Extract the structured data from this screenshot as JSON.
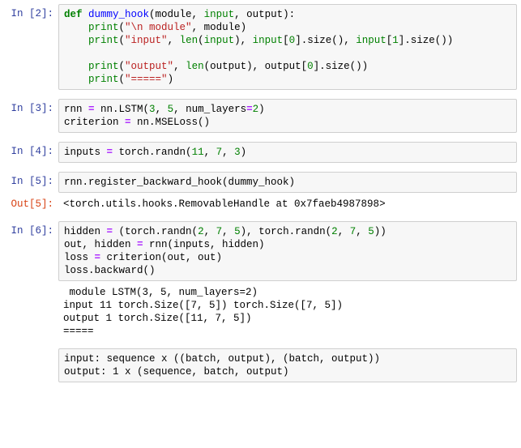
{
  "notebook": {
    "cells": [
      {
        "kind": "code",
        "prompt": "In [2]:",
        "name": "cell-in-2",
        "lines": [
          [
            {
              "t": "def",
              "c": "k"
            },
            {
              "t": " ",
              "c": "n"
            },
            {
              "t": "dummy_hook",
              "c": "nf"
            },
            {
              "t": "(module, ",
              "c": "n"
            },
            {
              "t": "input",
              "c": "nb"
            },
            {
              "t": ", output):",
              "c": "n"
            }
          ],
          [
            {
              "t": "    ",
              "c": "n"
            },
            {
              "t": "print",
              "c": "nb"
            },
            {
              "t": "(",
              "c": "n"
            },
            {
              "t": "\"\\n module\"",
              "c": "s"
            },
            {
              "t": ", module)",
              "c": "n"
            }
          ],
          [
            {
              "t": "    ",
              "c": "n"
            },
            {
              "t": "print",
              "c": "nb"
            },
            {
              "t": "(",
              "c": "n"
            },
            {
              "t": "\"input\"",
              "c": "s"
            },
            {
              "t": ", ",
              "c": "n"
            },
            {
              "t": "len",
              "c": "nb"
            },
            {
              "t": "(",
              "c": "n"
            },
            {
              "t": "input",
              "c": "nb"
            },
            {
              "t": "), ",
              "c": "n"
            },
            {
              "t": "input",
              "c": "nb"
            },
            {
              "t": "[",
              "c": "n"
            },
            {
              "t": "0",
              "c": "mi"
            },
            {
              "t": "].size(), ",
              "c": "n"
            },
            {
              "t": "input",
              "c": "nb"
            },
            {
              "t": "[",
              "c": "n"
            },
            {
              "t": "1",
              "c": "mi"
            },
            {
              "t": "].size())",
              "c": "n"
            }
          ],
          [
            {
              "t": "",
              "c": "n"
            }
          ],
          [
            {
              "t": "    ",
              "c": "n"
            },
            {
              "t": "print",
              "c": "nb"
            },
            {
              "t": "(",
              "c": "n"
            },
            {
              "t": "\"output\"",
              "c": "s"
            },
            {
              "t": ", ",
              "c": "n"
            },
            {
              "t": "len",
              "c": "nb"
            },
            {
              "t": "(output), output[",
              "c": "n"
            },
            {
              "t": "0",
              "c": "mi"
            },
            {
              "t": "].size())",
              "c": "n"
            }
          ],
          [
            {
              "t": "    ",
              "c": "n"
            },
            {
              "t": "print",
              "c": "nb"
            },
            {
              "t": "(",
              "c": "n"
            },
            {
              "t": "\"=====\"",
              "c": "s"
            },
            {
              "t": ")",
              "c": "n"
            }
          ]
        ]
      },
      {
        "kind": "code",
        "prompt": "In [3]:",
        "name": "cell-in-3",
        "lines": [
          [
            {
              "t": "rnn ",
              "c": "n"
            },
            {
              "t": "=",
              "c": "o"
            },
            {
              "t": " nn.LSTM(",
              "c": "n"
            },
            {
              "t": "3",
              "c": "mi"
            },
            {
              "t": ", ",
              "c": "n"
            },
            {
              "t": "5",
              "c": "mi"
            },
            {
              "t": ", num_layers",
              "c": "n"
            },
            {
              "t": "=",
              "c": "o"
            },
            {
              "t": "2",
              "c": "mi"
            },
            {
              "t": ")",
              "c": "n"
            }
          ],
          [
            {
              "t": "criterion ",
              "c": "n"
            },
            {
              "t": "=",
              "c": "o"
            },
            {
              "t": " nn.MSELoss()",
              "c": "n"
            }
          ]
        ]
      },
      {
        "kind": "code",
        "prompt": "In [4]:",
        "name": "cell-in-4",
        "lines": [
          [
            {
              "t": "inputs ",
              "c": "n"
            },
            {
              "t": "=",
              "c": "o"
            },
            {
              "t": " torch.randn(",
              "c": "n"
            },
            {
              "t": "11",
              "c": "mi"
            },
            {
              "t": ", ",
              "c": "n"
            },
            {
              "t": "7",
              "c": "mi"
            },
            {
              "t": ", ",
              "c": "n"
            },
            {
              "t": "3",
              "c": "mi"
            },
            {
              "t": ")",
              "c": "n"
            }
          ]
        ]
      },
      {
        "kind": "code",
        "prompt": "In [5]:",
        "name": "cell-in-5",
        "tight": true,
        "lines": [
          [
            {
              "t": "rnn.register_backward_hook",
              "c": "n"
            },
            {
              "t": "(dummy_hook)",
              "c": "n"
            }
          ]
        ]
      },
      {
        "kind": "result",
        "prompt": "Out[5]:",
        "name": "cell-out-5",
        "text": "<torch.utils.hooks.RemovableHandle at 0x7faeb4987898>"
      },
      {
        "kind": "code",
        "prompt": "In [6]:",
        "name": "cell-in-6",
        "tight": true,
        "lines": [
          [
            {
              "t": "hidden ",
              "c": "n"
            },
            {
              "t": "=",
              "c": "o"
            },
            {
              "t": " (torch.randn(",
              "c": "n"
            },
            {
              "t": "2",
              "c": "mi"
            },
            {
              "t": ", ",
              "c": "n"
            },
            {
              "t": "7",
              "c": "mi"
            },
            {
              "t": ", ",
              "c": "n"
            },
            {
              "t": "5",
              "c": "mi"
            },
            {
              "t": "), torch.randn(",
              "c": "n"
            },
            {
              "t": "2",
              "c": "mi"
            },
            {
              "t": ", ",
              "c": "n"
            },
            {
              "t": "7",
              "c": "mi"
            },
            {
              "t": ", ",
              "c": "n"
            },
            {
              "t": "5",
              "c": "mi"
            },
            {
              "t": "))",
              "c": "n"
            }
          ],
          [
            {
              "t": "out, hidden ",
              "c": "n"
            },
            {
              "t": "=",
              "c": "o"
            },
            {
              "t": " rnn(inputs, hidden)",
              "c": "n"
            }
          ],
          [
            {
              "t": "loss ",
              "c": "n"
            },
            {
              "t": "=",
              "c": "o"
            },
            {
              "t": " criterion(out, out)",
              "c": "n"
            }
          ],
          [
            {
              "t": "loss.backward()",
              "c": "n"
            }
          ]
        ]
      },
      {
        "kind": "stdout",
        "prompt": "",
        "name": "cell-stdout-6",
        "text": " module LSTM(3, 5, num_layers=2)\ninput 11 torch.Size([7, 5]) torch.Size([7, 5])\noutput 1 torch.Size([11, 7, 5])\n====="
      },
      {
        "kind": "code",
        "prompt": "",
        "name": "cell-in-notes",
        "lines": [
          [
            {
              "t": "input: sequence x ((batch, output), (batch, output))",
              "c": "n"
            }
          ],
          [
            {
              "t": "output: 1 x (sequence, batch, output)",
              "c": "n"
            }
          ]
        ]
      }
    ]
  },
  "colors": {
    "background": "#ffffff",
    "cell_background": "#f7f7f7",
    "cell_border": "#cfcfcf",
    "in_prompt": "#303f9f",
    "out_prompt": "#d84315",
    "keyword": "#008000",
    "function_name": "#0000ff",
    "builtin": "#008000",
    "string": "#ba2121",
    "number": "#008000",
    "operator": "#aa22ff",
    "text": "#000000"
  }
}
